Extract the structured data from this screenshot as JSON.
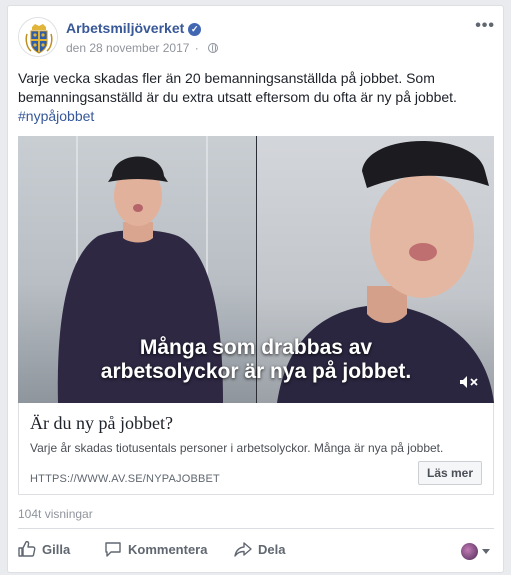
{
  "post": {
    "page_name": "Arbetsmiljöverket",
    "date": "den 28 november 2017",
    "more_label": "•••",
    "text_line1": "Varje vecka skadas fler än 20 bemanningsanställda på jobbet. Som",
    "text_line2": "bemanningsanställd är du extra utsatt eftersom du ofta är ny på jobbet.",
    "hashtag": "#nypåjobbet"
  },
  "video": {
    "caption_line1": "Många som drabbas av",
    "caption_line2": "arbetsolyckor är nya på jobbet."
  },
  "link": {
    "title": "Är du ny på jobbet?",
    "description": "Varje år skadas tiotusentals personer i arbetsolyckor. Många är nya på jobbet.",
    "url": "HTTPS://WWW.AV.SE/NYPAJOBBET",
    "cta": "Läs mer"
  },
  "stats": {
    "views": "104t visningar"
  },
  "actions": {
    "like": "Gilla",
    "comment": "Kommentera",
    "share": "Dela"
  },
  "icons": {
    "verified": "verified-badge-icon",
    "privacy": "globe-icon",
    "mute": "muted-speaker-icon",
    "like": "thumbs-up-icon",
    "comment": "speech-bubble-icon",
    "share": "share-arrow-icon"
  },
  "colors": {
    "link_blue": "#385898",
    "fb_blue": "#4267b2",
    "muted_text": "#90949c"
  }
}
